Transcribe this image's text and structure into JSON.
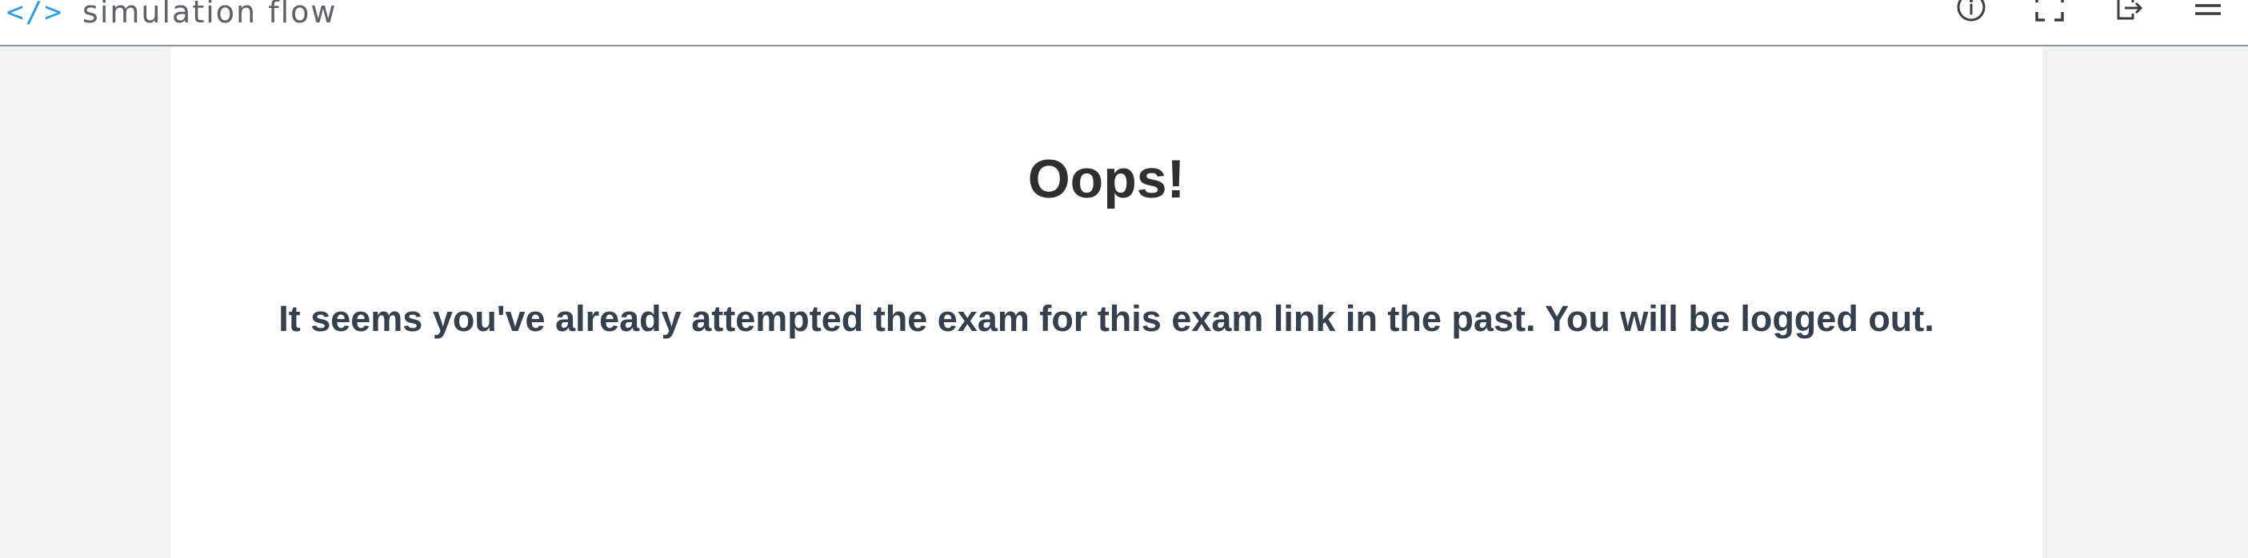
{
  "header": {
    "brand_code": "</>",
    "brand_name": "simulation flow",
    "icons": [
      {
        "name": "info-icon"
      },
      {
        "name": "fullscreen-icon"
      },
      {
        "name": "exit-icon"
      },
      {
        "name": "menu-icon"
      }
    ],
    "accent_color": "#2f9be0"
  },
  "main": {
    "title": "Oops!",
    "message": "It seems you've already attempted the exam for this exam link in the past. You will be logged out."
  }
}
